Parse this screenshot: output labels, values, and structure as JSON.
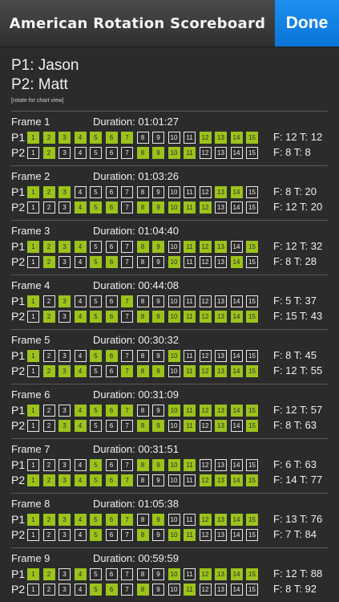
{
  "header": {
    "title": "American Rotation Scoreboard",
    "done_label": "Done"
  },
  "players": {
    "p1": "P1: Jason",
    "p2": "P2: Matt",
    "note": "[rotate for chart view]"
  },
  "colors": {
    "made": "#9bc31c",
    "done": "#0a73d8",
    "background": "#2b2b2b"
  },
  "frames": [
    {
      "label": "Frame 1",
      "duration": "Duration: 01:01:27",
      "p1": {
        "label": "P1",
        "made": [
          1,
          2,
          3,
          4,
          5,
          6,
          7,
          12,
          13,
          14,
          15
        ],
        "score": "F: 12  T: 12"
      },
      "p2": {
        "label": "P2",
        "made": [
          2,
          8,
          9,
          10,
          11
        ],
        "score": "F: 8  T: 8"
      }
    },
    {
      "label": "Frame 2",
      "duration": "Duration: 01:03:26",
      "p1": {
        "label": "P1",
        "made": [
          1,
          2,
          3,
          13,
          14
        ],
        "score": "F: 8  T: 20"
      },
      "p2": {
        "label": "P2",
        "made": [
          4,
          5,
          6,
          8,
          9,
          10,
          11,
          12
        ],
        "score": "F: 12  T: 20"
      }
    },
    {
      "label": "Frame 3",
      "duration": "Duration: 01:04:40",
      "p1": {
        "label": "P1",
        "made": [
          1,
          2,
          3,
          4,
          8,
          9,
          11,
          12,
          13,
          15
        ],
        "score": "F: 12  T: 32"
      },
      "p2": {
        "label": "P2",
        "made": [
          2,
          5,
          6,
          10,
          14
        ],
        "score": "F: 8  T: 28"
      }
    },
    {
      "label": "Frame 4",
      "duration": "Duration: 00:44:08",
      "p1": {
        "label": "P1",
        "made": [
          1,
          3,
          7
        ],
        "score": "F: 5  T: 37"
      },
      "p2": {
        "label": "P2",
        "made": [
          2,
          4,
          5,
          6,
          8,
          9,
          10,
          11,
          12,
          13,
          14,
          15
        ],
        "score": "F: 15  T: 43"
      }
    },
    {
      "label": "Frame 5",
      "duration": "Duration: 00:30:32",
      "p1": {
        "label": "P1",
        "made": [
          1,
          5,
          6,
          10
        ],
        "score": "F: 8  T: 45"
      },
      "p2": {
        "label": "P2",
        "made": [
          2,
          3,
          4,
          7,
          8,
          9,
          11,
          12,
          13,
          14,
          15
        ],
        "score": "F: 12  T: 55"
      }
    },
    {
      "label": "Frame 6",
      "duration": "Duration: 00:31:09",
      "p1": {
        "label": "P1",
        "made": [
          1,
          4,
          5,
          6,
          7,
          10,
          11,
          12,
          13,
          14,
          15
        ],
        "score": "F: 12  T: 57"
      },
      "p2": {
        "label": "P2",
        "made": [
          3,
          4,
          8,
          9,
          11,
          13,
          15
        ],
        "score": "F: 8  T: 63"
      }
    },
    {
      "label": "Frame 7",
      "duration": "Duration: 00:31:51",
      "p1": {
        "label": "P1",
        "made": [
          5,
          8,
          9,
          10,
          11
        ],
        "score": "F: 6  T: 63"
      },
      "p2": {
        "label": "P2",
        "made": [
          1,
          2,
          3,
          4,
          5,
          6,
          7,
          12,
          13,
          14,
          15
        ],
        "score": "F: 14  T: 77"
      }
    },
    {
      "label": "Frame 8",
      "duration": "Duration: 01:05:38",
      "p1": {
        "label": "P1",
        "made": [
          1,
          2,
          3,
          4,
          5,
          6,
          7,
          9,
          12,
          13,
          14,
          15
        ],
        "score": "F: 13  T: 76"
      },
      "p2": {
        "label": "P2",
        "made": [
          5,
          8,
          10,
          11
        ],
        "score": "F: 7  T: 84"
      }
    },
    {
      "label": "Frame 9",
      "duration": "Duration: 00:59:59",
      "p1": {
        "label": "P1",
        "made": [
          1,
          2,
          4,
          10,
          12,
          13,
          14,
          15
        ],
        "score": "F: 12  T: 88"
      },
      "p2": {
        "label": "P2",
        "made": [
          5,
          6,
          8,
          11
        ],
        "score": "F: 8  T: 92"
      }
    }
  ]
}
